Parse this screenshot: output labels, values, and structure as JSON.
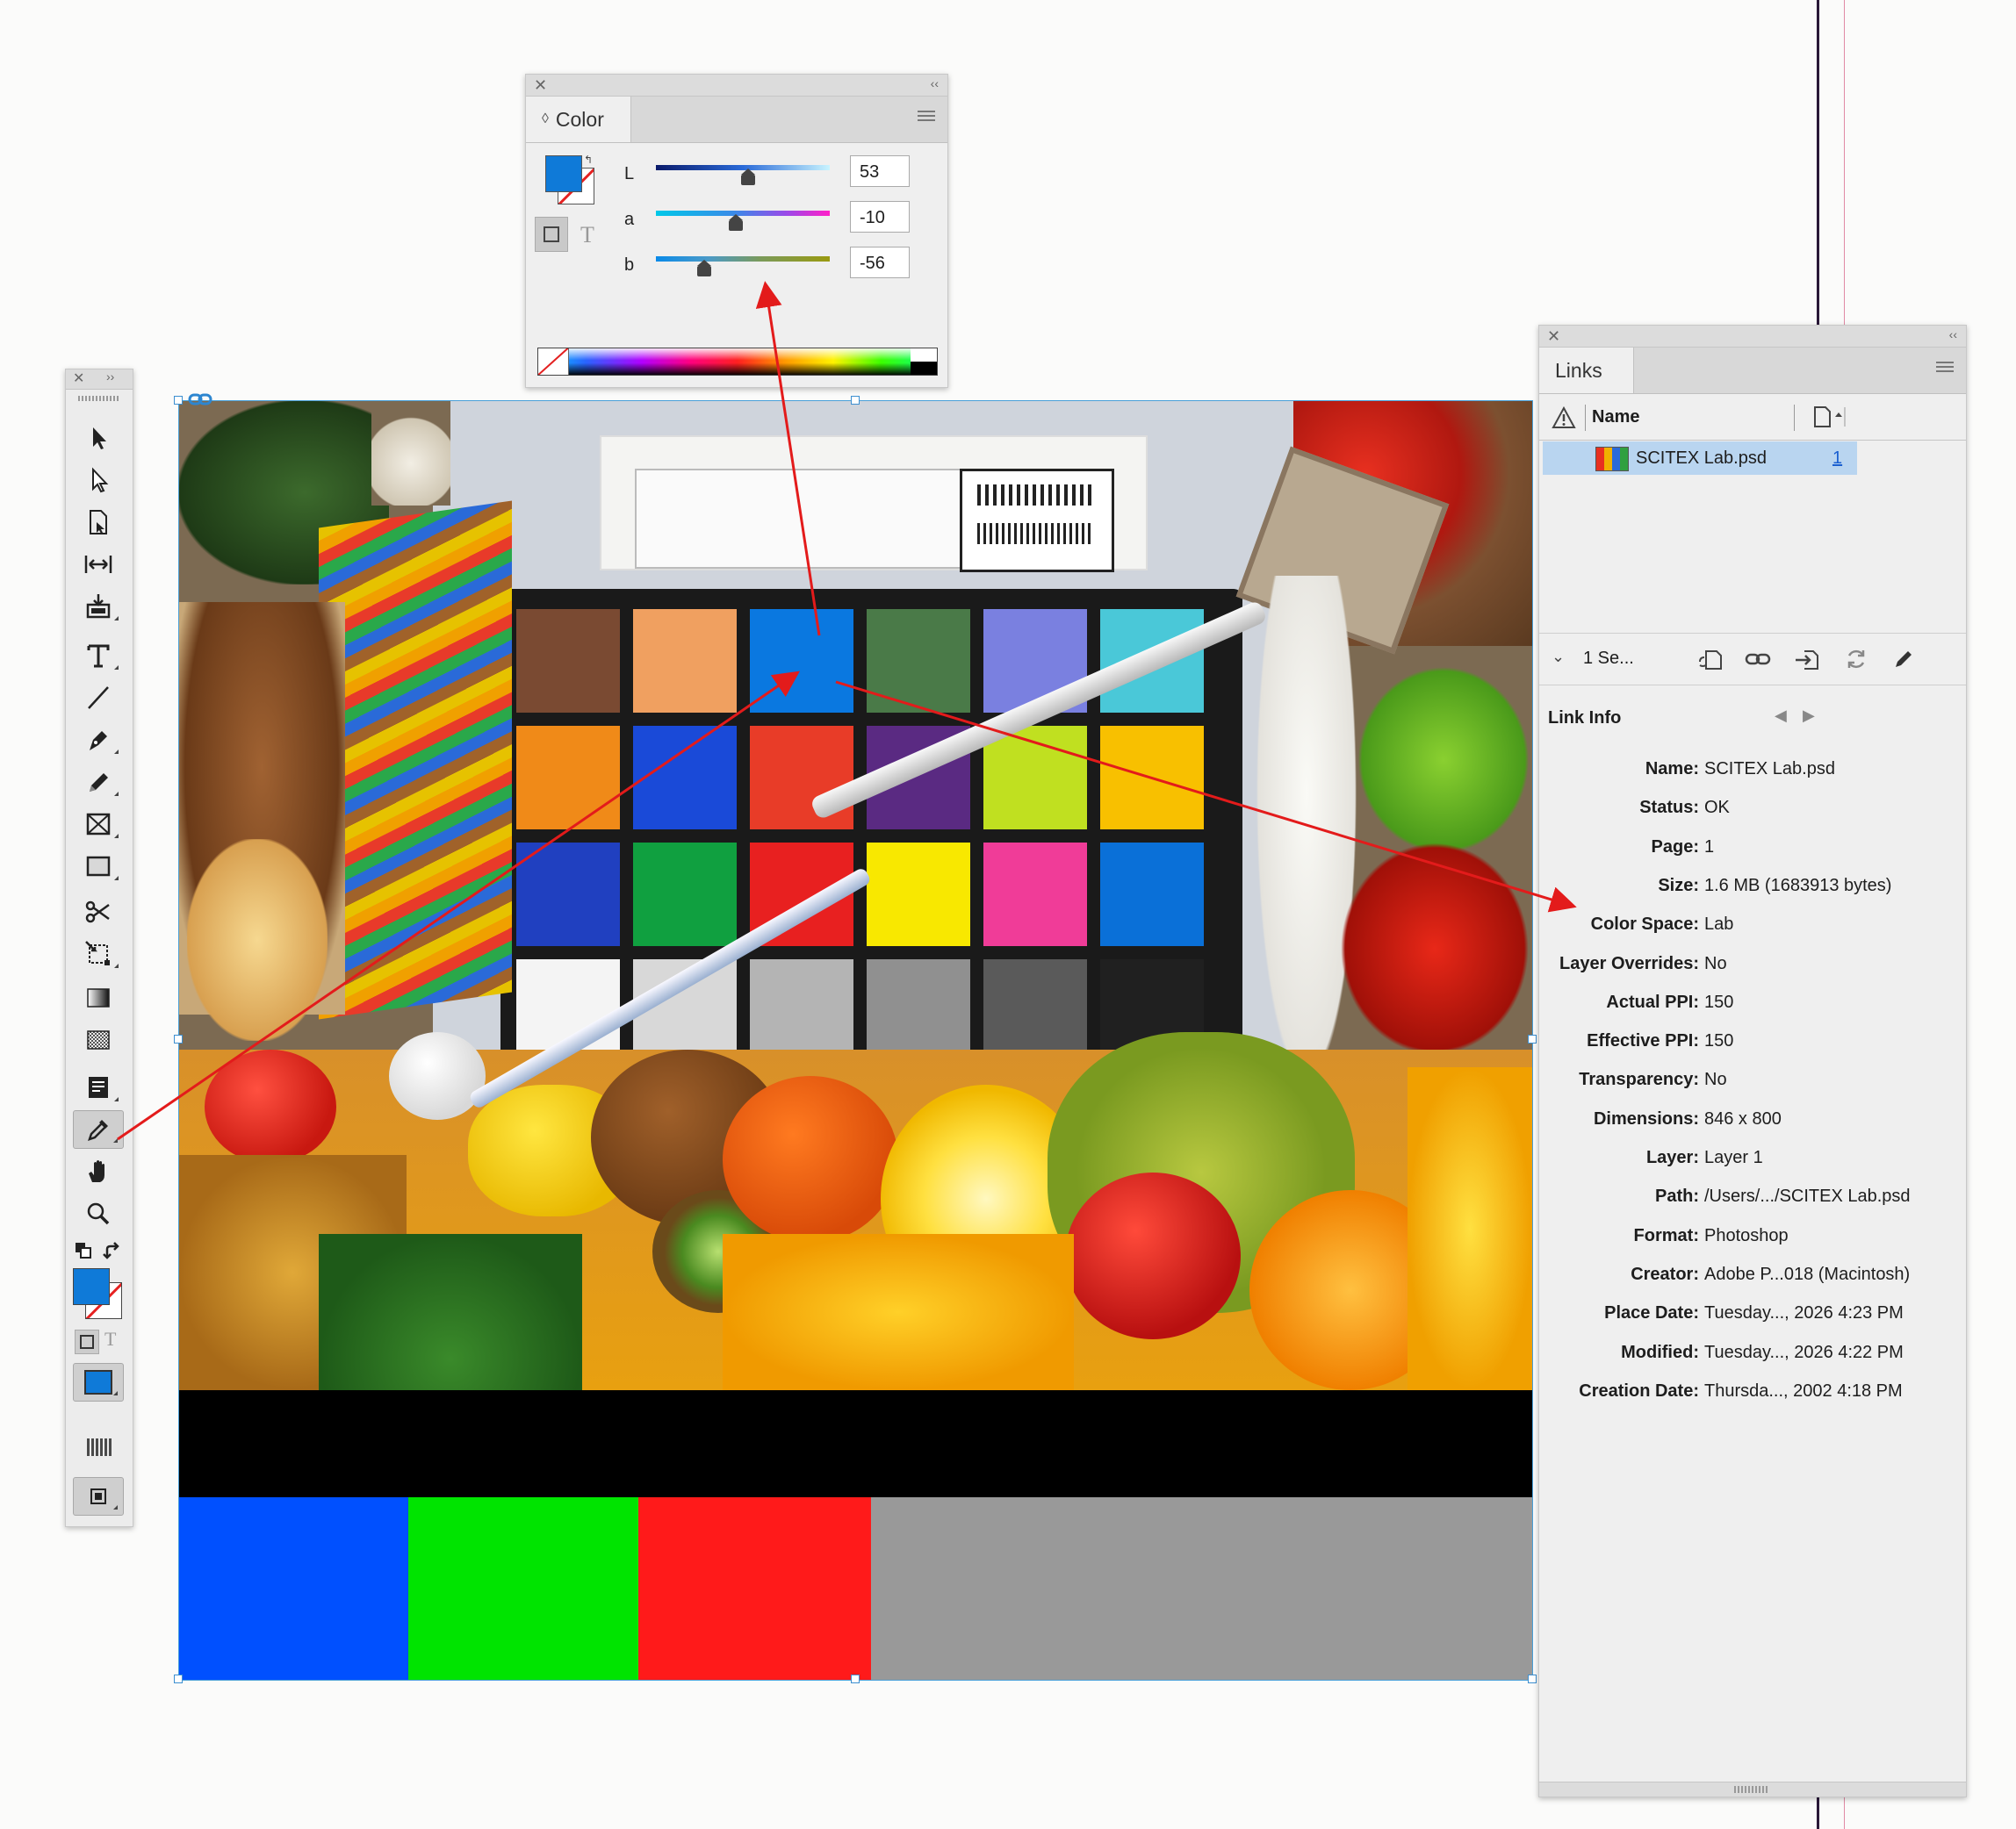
{
  "colors": {
    "fill_swatch": "#0f7ad8",
    "selection": "#b9d5f0",
    "arrow": "#e31b1b"
  },
  "color_panel": {
    "tab_label": "Color",
    "mode_indicator": "◊",
    "sliders": [
      {
        "label": "L",
        "value": "53",
        "position": 0.53
      },
      {
        "label": "a",
        "value": "-10",
        "position": 0.46
      },
      {
        "label": "b",
        "value": "-56",
        "position": 0.28
      }
    ],
    "format_text_glyph": "T"
  },
  "tools_panel": {
    "tools": [
      "selection",
      "direct-selection",
      "page",
      "gap",
      "content-collector",
      "type",
      "line",
      "pen",
      "pencil",
      "rectangle-frame",
      "rectangle",
      "scissors",
      "free-transform",
      "gradient-swatch",
      "gradient-feather",
      "note",
      "eyedropper",
      "hand",
      "zoom"
    ],
    "selected_tool": "eyedropper"
  },
  "links_panel": {
    "tab_label": "Links",
    "column_name": "Name",
    "link": {
      "name": "SCITEX Lab.psd",
      "page": "1"
    },
    "footer_status": "1 Se...",
    "link_info_title": "Link Info",
    "info": [
      {
        "key": "Name:",
        "value": "SCITEX Lab.psd"
      },
      {
        "key": "Status:",
        "value": "OK"
      },
      {
        "key": "Page:",
        "value": "1"
      },
      {
        "key": "Size:",
        "value": "1.6 MB (1683913 bytes)"
      },
      {
        "key": "Color Space:",
        "value": "Lab"
      },
      {
        "key": "Layer Overrides:",
        "value": "No"
      },
      {
        "key": "Actual PPI:",
        "value": "150"
      },
      {
        "key": "Effective PPI:",
        "value": "150"
      },
      {
        "key": "Transparency:",
        "value": "No"
      },
      {
        "key": "Dimensions:",
        "value": "846 x 800"
      },
      {
        "key": "Layer:",
        "value": "Layer 1"
      },
      {
        "key": "Path:",
        "value": "/Users/.../SCITEX Lab.psd"
      },
      {
        "key": "Format:",
        "value": "Photoshop"
      },
      {
        "key": "Creator:",
        "value": "Adobe P...018 (Macintosh)"
      },
      {
        "key": "Place Date:",
        "value": "Tuesday..., 2026 4:23 PM"
      },
      {
        "key": "Modified:",
        "value": "Tuesday..., 2026 4:22 PM"
      },
      {
        "key": "Creation Date:",
        "value": "Thursda..., 2002 4:18 PM"
      }
    ]
  },
  "image": {
    "chart_patches": [
      "#7a4a32",
      "#f0a060",
      "#0a78e0",
      "#4a7a48",
      "#7a80e0",
      "#4ac8d8",
      "#f08a18",
      "#1a4ad8",
      "#e83c28",
      "#5a2a82",
      "#c0e020",
      "#f8c000",
      "#2040c0",
      "#10a040",
      "#e82020",
      "#f8e800",
      "#f03c98",
      "#0a70d8",
      "#f4f4f4",
      "#d8d8d8",
      "#b4b4b4",
      "#909090",
      "#5a5a5a",
      "#202020"
    ],
    "bottom_bars": [
      "#0050ff",
      "#00e400",
      "#ff1a1a",
      "#999999"
    ]
  }
}
